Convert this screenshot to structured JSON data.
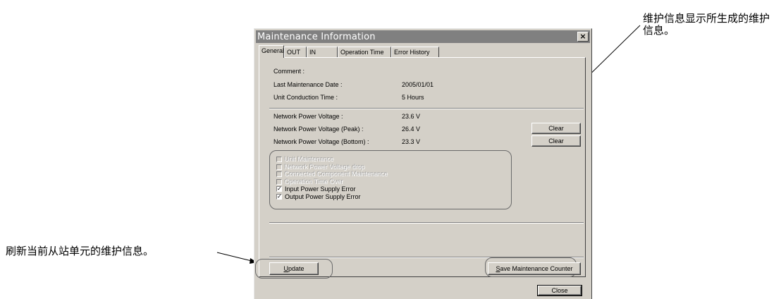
{
  "annotations": {
    "top_right": "维护信息显示所生成的维护信息。",
    "left": "刷新当前从站单元的维护信息。"
  },
  "window": {
    "title": "Maintenance Information",
    "close_glyph": "×"
  },
  "tabs": [
    "General",
    "OUT",
    "IN",
    "Operation Time",
    "Error History"
  ],
  "general": {
    "comment_label": "Comment :",
    "last_maintenance_label": "Last Maintenance Date :",
    "last_maintenance_value": "2005/01/01",
    "conduction_label": "Unit Conduction Time :",
    "conduction_value": "5 Hours",
    "voltage_label": "Network Power Voltage :",
    "voltage_value": "23.6 V",
    "voltage_peak_label": "Network Power Voltage (Peak) :",
    "voltage_peak_value": "26.4 V",
    "voltage_bottom_label": "Network Power Voltage (Bottom) :",
    "voltage_bottom_value": "23.3 V",
    "clear_label": "Clear"
  },
  "checks": [
    {
      "label": "Unit Maintenance",
      "checked": false,
      "disabled": true
    },
    {
      "label": "Network Power Voltage drop",
      "checked": false,
      "disabled": true
    },
    {
      "label": "Connected Component Maintenance",
      "checked": false,
      "disabled": true
    },
    {
      "label": "Operation Time Over",
      "checked": false,
      "disabled": true
    },
    {
      "label": "Input Power Supply Error",
      "checked": true,
      "disabled": false
    },
    {
      "label": "Output Power Supply Error",
      "checked": true,
      "disabled": false
    }
  ],
  "check_glyph": "✓",
  "buttons": {
    "update_mnemonic": "U",
    "update_rest": "pdate",
    "save_mnemonic": "S",
    "save_rest": "ave Maintenance Counter",
    "close": "Close"
  }
}
